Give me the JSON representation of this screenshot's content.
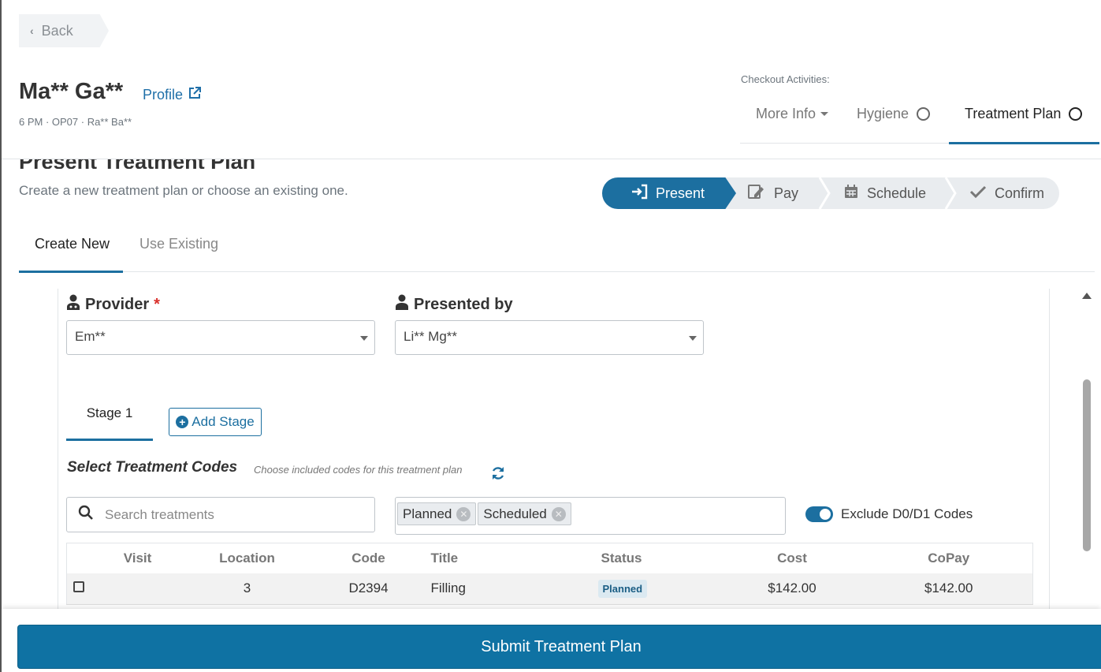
{
  "header": {
    "back_label": "Back",
    "patient_name": "Ma** Ga**",
    "profile_label": "Profile",
    "appointment_meta": "6 PM · OP07 · Ra** Ba**",
    "checkout_label": "Checkout Activities:",
    "activity_tabs": [
      {
        "label": "More Info"
      },
      {
        "label": "Hygiene"
      },
      {
        "label": "Treatment Plan"
      }
    ]
  },
  "section": {
    "title": "Present Treatment Plan",
    "subtitle": "Create a new treatment plan or choose an existing one."
  },
  "stepper": {
    "steps": [
      {
        "label": "Present",
        "icon": "sign-in-icon"
      },
      {
        "label": "Pay",
        "icon": "signature-icon"
      },
      {
        "label": "Schedule",
        "icon": "calendar-icon"
      },
      {
        "label": "Confirm",
        "icon": "check-icon"
      }
    ]
  },
  "plan_tabs": [
    {
      "label": "Create New"
    },
    {
      "label": "Use Existing"
    }
  ],
  "form": {
    "provider_label": "Provider",
    "provider_required": "*",
    "provider_value": "Em**",
    "presented_by_label": "Presented by",
    "presented_by_value": "Li** Mg**"
  },
  "stages": {
    "current": "Stage 1",
    "add_label": "Add Stage"
  },
  "codes": {
    "title": "Select Treatment Codes",
    "subtitle": "Choose included codes for this treatment plan",
    "search_placeholder": "Search treatments",
    "status_filters": [
      "Planned",
      "Scheduled"
    ],
    "exclude_label": "Exclude D0/D1 Codes"
  },
  "table": {
    "columns": [
      "Visit",
      "Location",
      "Code",
      "Title",
      "Status",
      "Cost",
      "CoPay"
    ],
    "rows": [
      {
        "visit": "",
        "location": "3",
        "code": "D2394",
        "title": "Filling",
        "status": "Planned",
        "cost": "$142.00",
        "copay": "$142.00"
      }
    ]
  },
  "footer": {
    "submit_label": "Submit Treatment Plan"
  },
  "colors": {
    "accent": "#1c6fa0",
    "required": "#d9302c"
  }
}
